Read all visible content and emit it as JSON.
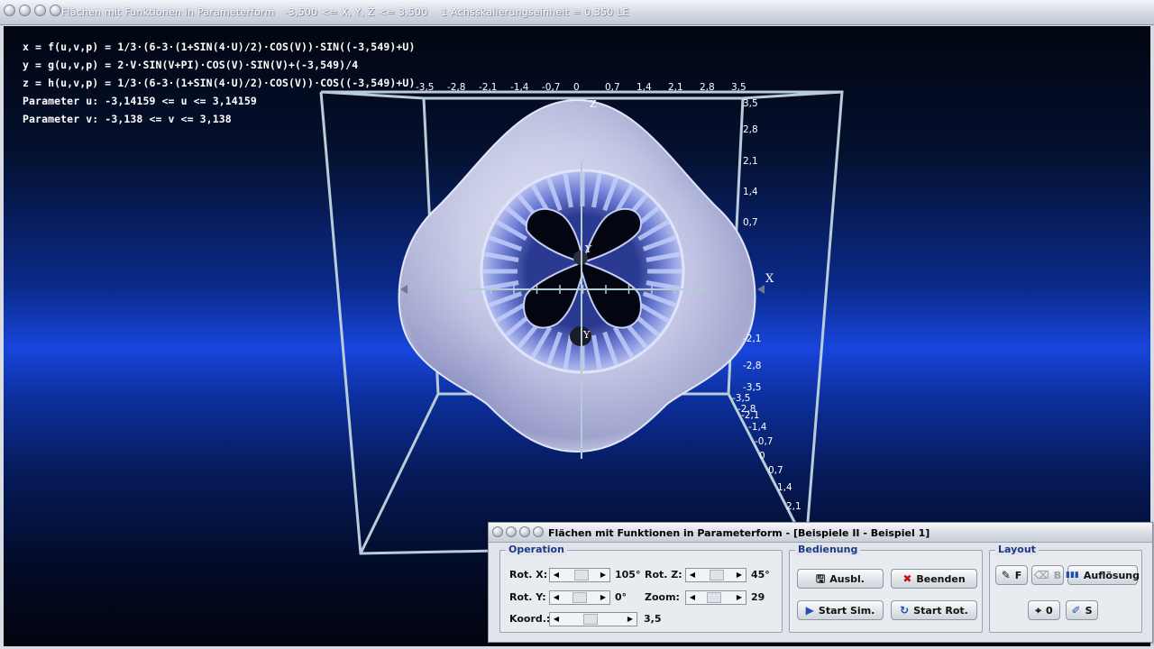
{
  "main_window": {
    "title": "Flächen mit Funktionen in Parameterform   -3,500 <= X, Y, Z <= 3,500    1 Achsskalierungseinheit = 0,350 LE"
  },
  "formulas": [
    "x = f(u,v,p) = 1/3·(6-3·(1+SIN(4·U)/2)·COS(V))·SIN((-3,549)+U)",
    "y = g(u,v,p) = 2·V·SIN(V+PI)·COS(V)·SIN(V)+(-3,549)/4",
    "z = h(u,v,p) = 1/3·(6-3·(1+SIN(4·U)/2)·COS(V))·COS((-3,549)+U)",
    "Parameter u: -3,14159 <= u <= 3,14159",
    "Parameter v: -3,138 <= v <= 3,138"
  ],
  "axes": {
    "x_label": "X",
    "y_label": "Y",
    "z_label": "Z",
    "top_ticks": [
      "-3,5",
      "-2,8",
      "-2,1",
      "-1,4",
      "-0,7",
      "0",
      "0,7",
      "1,4",
      "2,1",
      "2,8",
      "3,5"
    ],
    "right_ticks": [
      "3,5",
      "2,8",
      "2,1",
      "1,4",
      "0,7",
      "-2,1",
      "-2,8",
      "-3,5"
    ],
    "depth_ticks": [
      "-3,5",
      "-2,8",
      "-2,1",
      "-1,4",
      "-0,7",
      "0",
      "0,7",
      "1,4",
      "2,1"
    ]
  },
  "dialog": {
    "title": "Flächen mit Funktionen in Parameterform - [Beispiele II - Beispiel 1]",
    "operation": {
      "label": "Operation",
      "rot_x_label": "Rot. X:",
      "rot_x_value": "105°",
      "rot_x_position": 0.58,
      "rot_y_label": "Rot. Y:",
      "rot_y_value": "0°",
      "rot_y_position": 0.5,
      "rot_z_label": "Rot. Z:",
      "rot_z_value": "45°",
      "rot_z_position": 0.56,
      "zoom_label": "Zoom:",
      "zoom_value": "29",
      "zoom_position": 0.4,
      "koord_label": "Koord.:",
      "koord_value": "3,5",
      "koord_position": 0.45
    },
    "bedienung": {
      "label": "Bedienung",
      "ausbl": "Ausbl.",
      "beenden": "Beenden",
      "start_sim": "Start Sim.",
      "start_rot": "Start Rot."
    },
    "layout": {
      "label": "Layout",
      "btn_f": "F",
      "btn_b": "B",
      "aufloesung": "Auflösung",
      "btn_0": "0",
      "btn_s": "S"
    }
  },
  "colors": {
    "title_text": "#ffffff",
    "group_label": "#1b3a8a",
    "beenden_icon": "#d01010",
    "play_icon": "#1f4fb0"
  }
}
